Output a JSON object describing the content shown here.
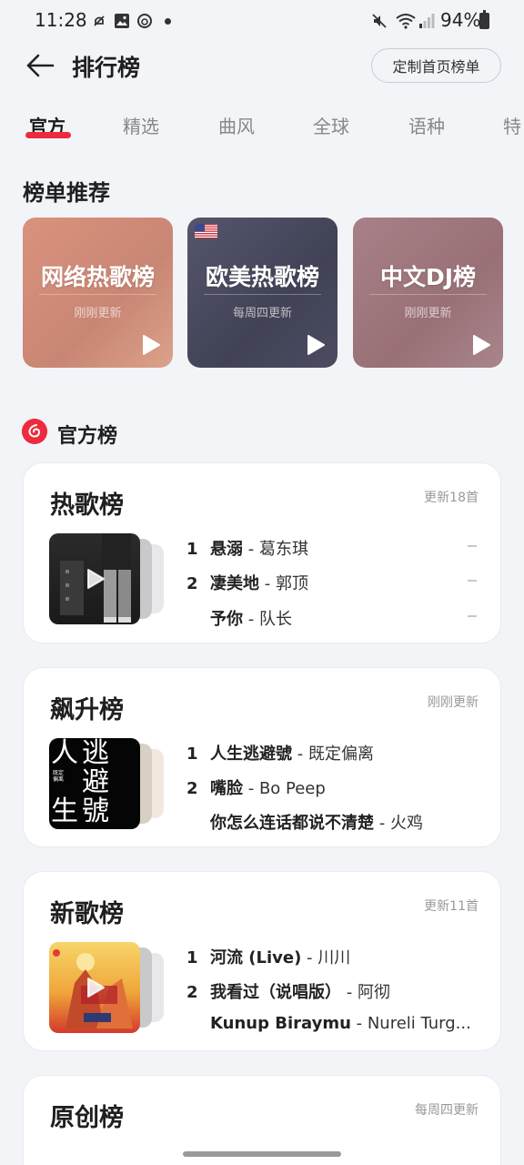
{
  "status_bar": {
    "time": "11:28",
    "battery": "94%"
  },
  "header": {
    "title": "排行榜",
    "custom_button": "定制首页榜单"
  },
  "tabs": [
    {
      "label": "官方",
      "active": true
    },
    {
      "label": "精选"
    },
    {
      "label": "曲风"
    },
    {
      "label": "全球"
    },
    {
      "label": "语种"
    },
    {
      "label": "特"
    }
  ],
  "recommend": {
    "title": "榜单推荐",
    "cards": [
      {
        "name": "网络热歌榜",
        "sub": "刚刚更新",
        "color": "#d38f7a"
      },
      {
        "name": "欧美热歌榜",
        "sub": "每周四更新",
        "color": "#4a4a60"
      },
      {
        "name": "中文DJ榜",
        "sub": "刚刚更新",
        "color": "#a27d83"
      }
    ]
  },
  "official": {
    "title": "官方榜",
    "charts": [
      {
        "name": "热歌榜",
        "update": "更新18首",
        "songs": [
          {
            "rank": "1",
            "title": "悬溺",
            "artist": " - 葛东琪"
          },
          {
            "rank": "2",
            "title": "凄美地",
            "artist": " - 郭顶"
          },
          {
            "rank": "",
            "title": "予你",
            "artist": " - 队长"
          }
        ]
      },
      {
        "name": "飙升榜",
        "update": "刚刚更新",
        "songs": [
          {
            "rank": "1",
            "title": "人生逃避號",
            "artist": " - 既定偏离"
          },
          {
            "rank": "2",
            "title": "嘴脸",
            "artist": " - Bo Peep"
          },
          {
            "rank": "",
            "title": "你怎么连话都说不清楚",
            "artist": " - 火鸡"
          }
        ],
        "cover_text": {
          "big": [
            "人",
            "逃",
            "避",
            "生",
            "號"
          ],
          "small": "既定偏离"
        }
      },
      {
        "name": "新歌榜",
        "update": "更新11首",
        "songs": [
          {
            "rank": "1",
            "title": "河流 (Live)",
            "artist": " - 川川"
          },
          {
            "rank": "2",
            "title": "我看过（说唱版）",
            "artist": " - 阿彻"
          },
          {
            "rank": "",
            "title": "Kunup Biraymu",
            "artist": " - Nureli Turg..."
          }
        ]
      },
      {
        "name": "原创榜",
        "update": "每周四更新"
      }
    ]
  },
  "colors": {
    "accent": "#ee2b3d",
    "background": "#f2f4f8"
  }
}
